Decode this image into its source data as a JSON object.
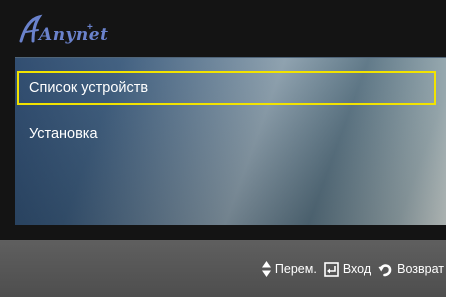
{
  "brand": {
    "logo_text": "Anynet",
    "logo_plus": "+"
  },
  "menu": {
    "items": [
      {
        "label": "Список устройств",
        "selected": true
      },
      {
        "label": "Установка",
        "selected": false
      }
    ]
  },
  "footer": {
    "hints": [
      {
        "icon": "up-down-arrows-icon",
        "label": "Перем."
      },
      {
        "icon": "enter-icon",
        "label": "Вход"
      },
      {
        "icon": "return-icon",
        "label": "Возврат"
      }
    ]
  },
  "colors": {
    "highlight_border": "#f2e300",
    "logo": "#6a82cc",
    "background": "#141414",
    "footer": "#585858"
  }
}
